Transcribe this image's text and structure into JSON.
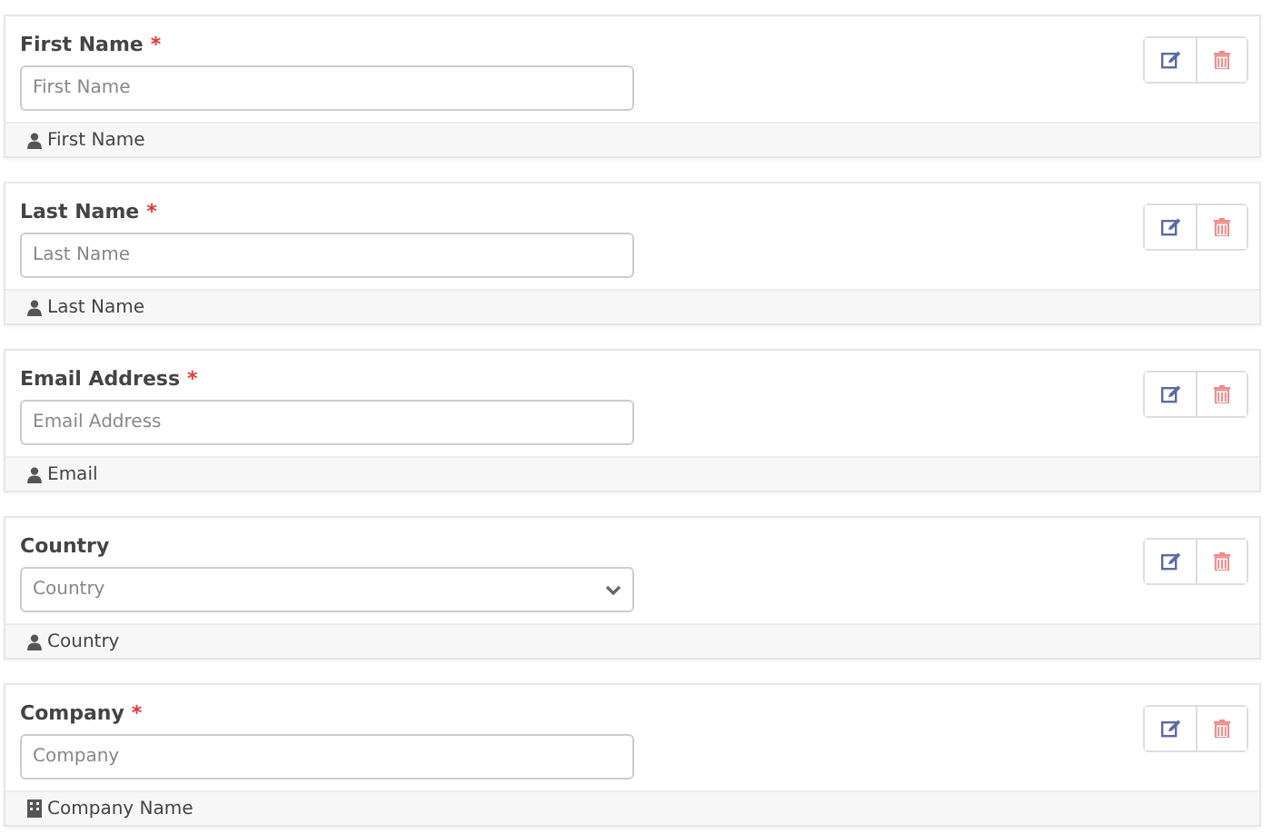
{
  "fields": [
    {
      "label": "First Name",
      "required_mark": "*",
      "kind": "text",
      "placeholder": "First Name",
      "footer": {
        "kind": "person",
        "text": "First Name"
      }
    },
    {
      "label": "Last Name",
      "required_mark": "*",
      "kind": "text",
      "placeholder": "Last Name",
      "footer": {
        "kind": "person",
        "text": "Last Name"
      }
    },
    {
      "label": "Email Address",
      "required_mark": "*",
      "kind": "text",
      "placeholder": "Email Address",
      "footer": {
        "kind": "person",
        "text": "Email"
      }
    },
    {
      "label": "Country",
      "kind": "select",
      "placeholder": "Country",
      "footer": {
        "kind": "person",
        "text": "Country"
      }
    },
    {
      "label": "Company",
      "required_mark": "*",
      "kind": "text",
      "placeholder": "Company",
      "footer": {
        "kind": "building",
        "text": "Company Name"
      }
    }
  ]
}
